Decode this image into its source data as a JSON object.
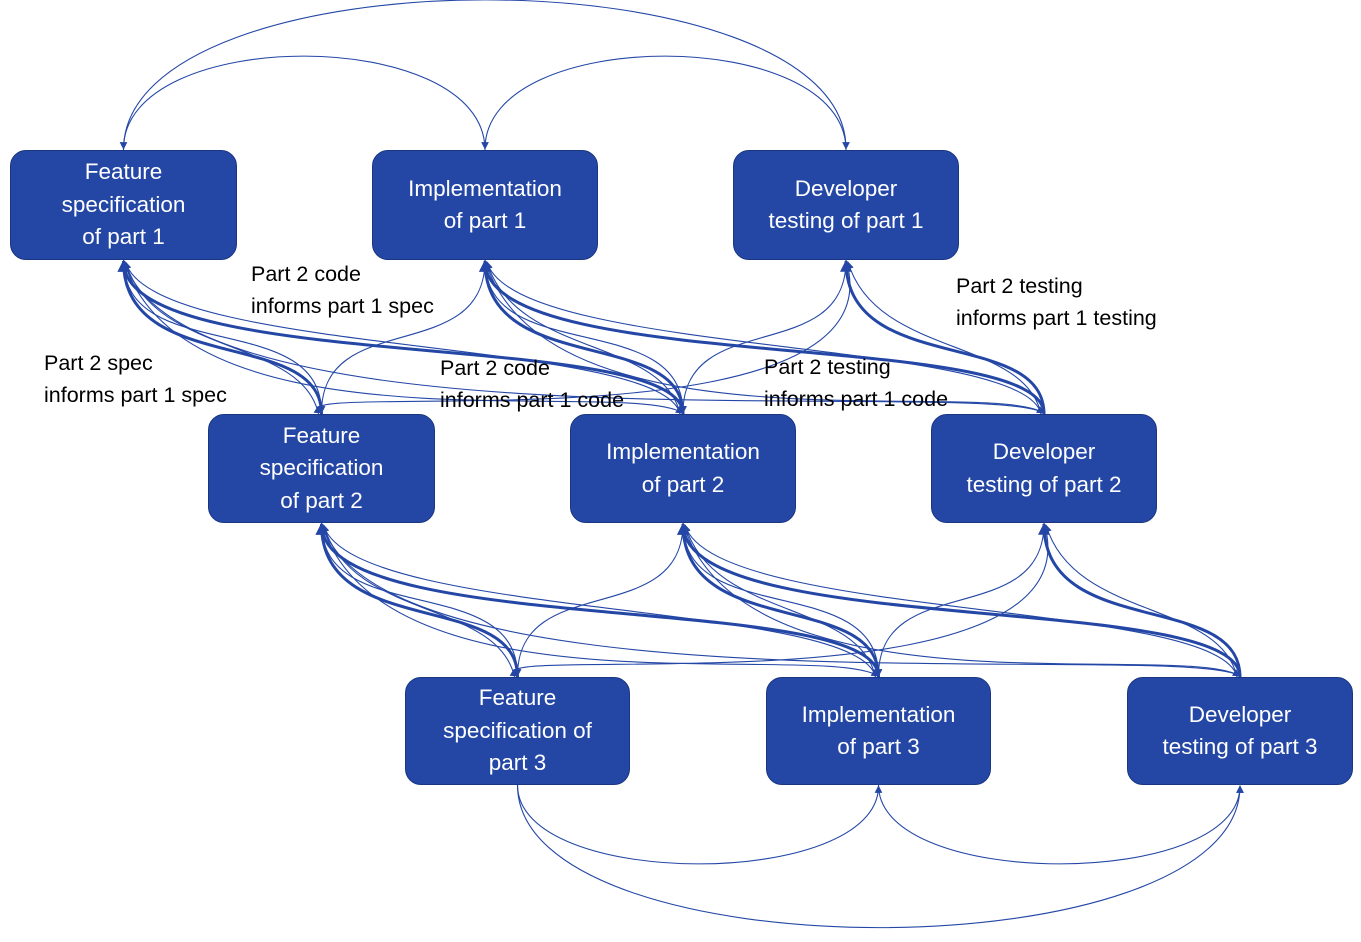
{
  "diagram": {
    "colors": {
      "node_fill": "#2447a6",
      "node_border": "#1a3680",
      "edge": "#2447a6",
      "node_text": "#ffffff",
      "label_text": "#000000"
    },
    "nodes": [
      {
        "id": "spec1",
        "lines": [
          "Feature",
          "specification",
          "of part 1"
        ]
      },
      {
        "id": "impl1",
        "lines": [
          "Implementation",
          "of part 1"
        ]
      },
      {
        "id": "test1",
        "lines": [
          "Developer",
          "testing of part 1"
        ]
      },
      {
        "id": "spec2",
        "lines": [
          "Feature",
          "specification",
          "of part 2"
        ]
      },
      {
        "id": "impl2",
        "lines": [
          "Implementation",
          "of part 2"
        ]
      },
      {
        "id": "test2",
        "lines": [
          "Developer",
          "testing of part 2"
        ]
      },
      {
        "id": "spec3",
        "lines": [
          "Feature",
          "specification of",
          "part 3"
        ]
      },
      {
        "id": "impl3",
        "lines": [
          "Implementation",
          "of part 3"
        ]
      },
      {
        "id": "test3",
        "lines": [
          "Developer",
          "testing of part 3"
        ]
      }
    ],
    "labels": [
      {
        "id": "code2-spec1",
        "lines": [
          "Part 2 code",
          "informs part 1 spec"
        ]
      },
      {
        "id": "spec2-spec1",
        "lines": [
          "Part 2 spec",
          "informs part 1 spec"
        ]
      },
      {
        "id": "code2-code1",
        "lines": [
          "Part 2 code",
          "informs part 1 code"
        ]
      },
      {
        "id": "test2-code1",
        "lines": [
          "Part 2 testing",
          "informs part 1 code"
        ]
      },
      {
        "id": "test2-test1",
        "lines": [
          "Part 2 testing",
          "informs part 1 testing"
        ]
      }
    ],
    "edges": {
      "same_row": [
        {
          "from": "spec1",
          "to": "impl1"
        },
        {
          "from": "impl1",
          "to": "test1"
        },
        {
          "from": "spec1",
          "to": "test1"
        },
        {
          "from": "spec3",
          "to": "impl3"
        },
        {
          "from": "impl3",
          "to": "test3"
        },
        {
          "from": "spec3",
          "to": "test3"
        }
      ],
      "feedback": [
        {
          "from": "spec2",
          "to": "spec1"
        },
        {
          "from": "impl2",
          "to": "spec1"
        },
        {
          "from": "impl2",
          "to": "impl1"
        },
        {
          "from": "test2",
          "to": "impl1"
        },
        {
          "from": "test2",
          "to": "test1"
        },
        {
          "from": "spec3",
          "to": "spec2"
        },
        {
          "from": "impl3",
          "to": "spec2"
        },
        {
          "from": "impl3",
          "to": "impl2"
        },
        {
          "from": "test3",
          "to": "impl2"
        },
        {
          "from": "test3",
          "to": "test2"
        }
      ],
      "forward": [
        {
          "from": "spec1",
          "to": "spec2"
        },
        {
          "from": "spec1",
          "to": "impl2"
        },
        {
          "from": "impl1",
          "to": "spec2"
        },
        {
          "from": "impl1",
          "to": "impl2"
        },
        {
          "from": "test1",
          "to": "impl2"
        },
        {
          "from": "test1",
          "to": "spec2"
        },
        {
          "from": "spec1",
          "to": "test2"
        },
        {
          "from": "impl1",
          "to": "test2"
        },
        {
          "from": "spec2",
          "to": "spec3"
        },
        {
          "from": "spec2",
          "to": "impl3"
        },
        {
          "from": "impl2",
          "to": "spec3"
        },
        {
          "from": "impl2",
          "to": "impl3"
        },
        {
          "from": "test2",
          "to": "impl3"
        },
        {
          "from": "test2",
          "to": "spec3"
        },
        {
          "from": "spec2",
          "to": "test3"
        },
        {
          "from": "impl2",
          "to": "test3"
        }
      ]
    }
  }
}
